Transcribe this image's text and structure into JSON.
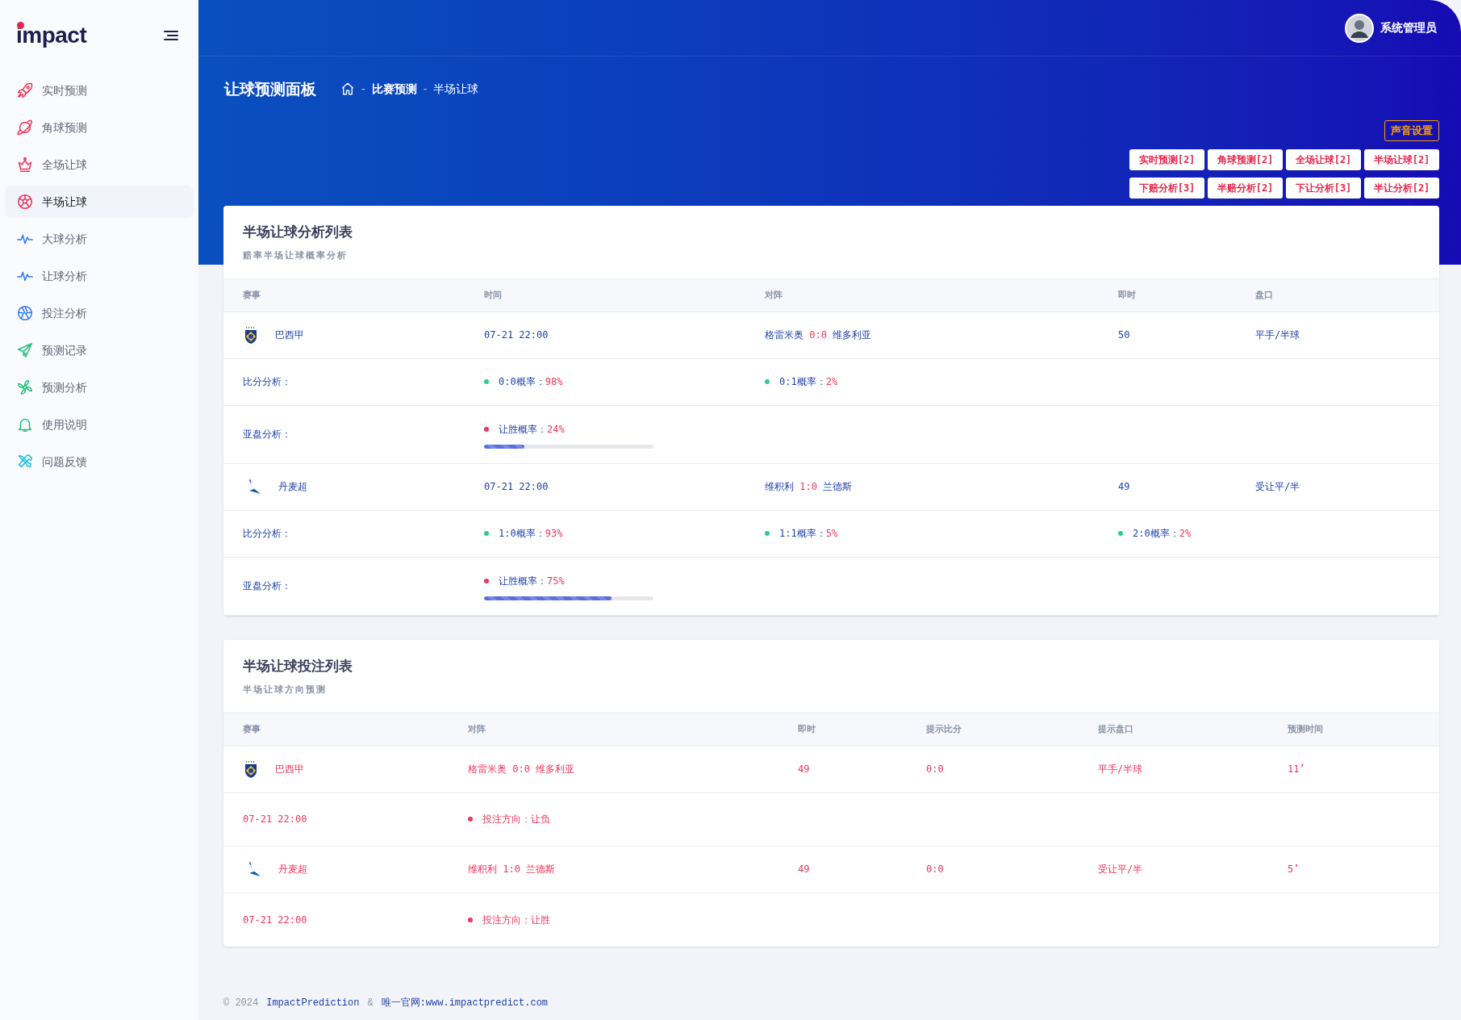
{
  "brand": {
    "logo": "impact"
  },
  "sidebar": {
    "items": [
      {
        "label": "实时预测",
        "selected": false
      },
      {
        "label": "角球预测",
        "selected": false
      },
      {
        "label": "全场让球",
        "selected": false
      },
      {
        "label": "半场让球",
        "selected": true
      },
      {
        "label": "大球分析",
        "selected": false
      },
      {
        "label": "让球分析",
        "selected": false
      },
      {
        "label": "投注分析",
        "selected": false
      },
      {
        "label": "预测记录",
        "selected": false
      },
      {
        "label": "预测分析",
        "selected": false
      },
      {
        "label": "使用说明",
        "selected": false
      },
      {
        "label": "问题反馈",
        "selected": false
      }
    ]
  },
  "header": {
    "user": "系统管理员",
    "page_title": "让球预测面板",
    "breadcrumb": [
      "比赛预测",
      "半场让球"
    ],
    "breadcrumb_separator": "-",
    "sound_button": "声音设置",
    "quick_buttons": [
      [
        "实时预测[2]",
        "角球预测[2]",
        "全场让球[2]",
        "半场让球[2]"
      ],
      [
        "下赔分析[3]",
        "半赔分析[2]",
        "下让分析[3]",
        "半让分析[2]"
      ]
    ]
  },
  "analysis_table": {
    "title": "半场让球分析列表",
    "subtitle": "赔率半场让球概率分析",
    "columns": [
      "赛事",
      "时间",
      "对阵",
      "即时",
      "盘口"
    ],
    "matches": [
      {
        "league": "巴西甲",
        "time": "07-21 22:00",
        "home": "格雷米奥",
        "score": "0:0",
        "away": "维多利亚",
        "live": "50",
        "handicap": "平手/半球",
        "score_label": "比分分析：",
        "score_analysis": [
          {
            "label": "0:0概率：",
            "prob": "98%"
          },
          {
            "label": "0:1概率：",
            "prob": "2%"
          }
        ],
        "asian_label": "亚盘分析：",
        "asian": {
          "label": "让胜概率：",
          "prob": "24%",
          "level": 0.24
        }
      },
      {
        "league": "丹麦超",
        "time": "07-21 22:00",
        "home": "维积利",
        "score": "1:0",
        "away": "兰德斯",
        "live": "49",
        "handicap": "受让平/半",
        "score_label": "比分分析：",
        "score_analysis": [
          {
            "label": "1:0概率：",
            "prob": "93%"
          },
          {
            "label": "1:1概率：",
            "prob": "5%"
          },
          {
            "label": "2:0概率：",
            "prob": "2%"
          }
        ],
        "asian_label": "亚盘分析：",
        "asian": {
          "label": "让胜概率：",
          "prob": "75%",
          "level": 0.75
        }
      }
    ]
  },
  "bet_table": {
    "title": "半场让球投注列表",
    "subtitle": "半场让球方向预测",
    "columns": [
      "赛事",
      "对阵",
      "即时",
      "提示比分",
      "提示盘口",
      "预测时间"
    ],
    "rows": [
      {
        "league": "巴西甲",
        "match": "格雷米奥 0:0 维多利亚",
        "live": "49",
        "tip_score": "0:0",
        "tip_handicap": "平手/半球",
        "predict_time": "11’",
        "time": "07-21 22:00",
        "direction": "投注方向：让负"
      },
      {
        "league": "丹麦超",
        "match": "维积利 1:0 兰德斯",
        "live": "49",
        "tip_score": "0:0",
        "tip_handicap": "受让平/半",
        "predict_time": "5’",
        "time": "07-21 22:00",
        "direction": "投注方向：让胜"
      }
    ]
  },
  "footer": {
    "copyright": "© 2024",
    "company": "ImpactPrediction",
    "separator": "&",
    "site": "唯一官网:www.impactpredict.com"
  }
}
